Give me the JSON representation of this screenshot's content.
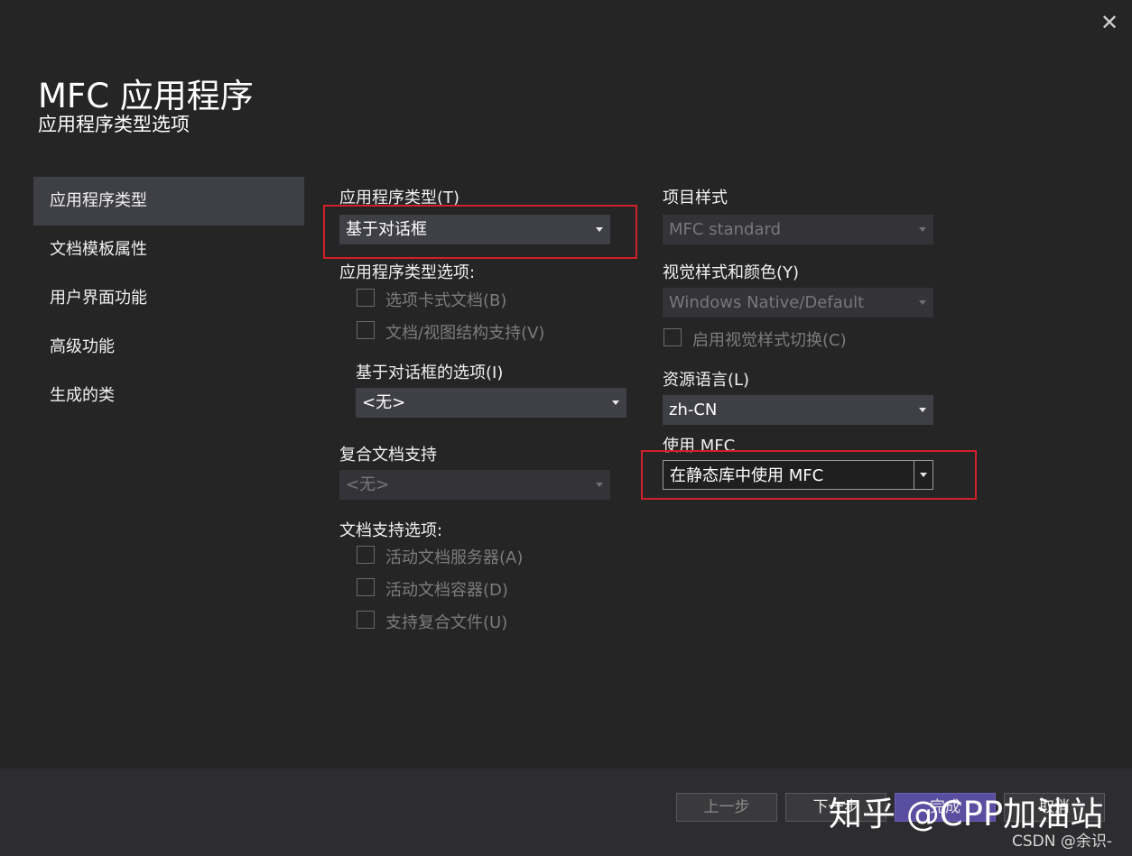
{
  "dialog": {
    "close_glyph": "✕",
    "title": "MFC 应用程序",
    "subtitle": "应用程序类型选项"
  },
  "nav": {
    "items": [
      {
        "label": "应用程序类型",
        "active": true
      },
      {
        "label": "文档模板属性"
      },
      {
        "label": "用户界面功能"
      },
      {
        "label": "高级功能"
      },
      {
        "label": "生成的类"
      }
    ]
  },
  "left_column": {
    "app_type": {
      "label": "应用程序类型(T)",
      "value": "基于对话框"
    },
    "app_type_options": {
      "label": "应用程序类型选项:",
      "checkboxes": [
        {
          "label": "选项卡式文档(B)",
          "checked": false,
          "enabled": false
        },
        {
          "label": "文档/视图结构支持(V)",
          "checked": false,
          "enabled": false
        }
      ]
    },
    "dialog_options": {
      "label": "基于对话框的选项(I)",
      "value": "<无>"
    },
    "compound_doc": {
      "label": "复合文档支持",
      "value": "<无>",
      "enabled": false
    },
    "doc_support": {
      "label": "文档支持选项:",
      "checkboxes": [
        {
          "label": "活动文档服务器(A)",
          "checked": false,
          "enabled": false
        },
        {
          "label": "活动文档容器(D)",
          "checked": false,
          "enabled": false
        },
        {
          "label": "支持复合文件(U)",
          "checked": false,
          "enabled": false
        }
      ]
    }
  },
  "right_column": {
    "project_style": {
      "label": "项目样式",
      "value": "MFC standard",
      "enabled": false
    },
    "visual_style": {
      "label": "视觉样式和颜色(Y)",
      "value": "Windows Native/Default",
      "enabled": false
    },
    "visual_switch": {
      "label": "启用视觉样式切换(C)",
      "checked": false,
      "enabled": false
    },
    "resource_lang": {
      "label": "资源语言(L)",
      "value": "zh-CN"
    },
    "use_mfc": {
      "label": "使用 MFC",
      "value": "在静态库中使用 MFC"
    }
  },
  "footer": {
    "back": "上一步",
    "next": "下一步",
    "finish": "完成",
    "cancel": "取消"
  },
  "overlay": {
    "watermark": "知乎 @CPP加油站",
    "credit": "CSDN @余识-"
  },
  "colors": {
    "background": "#252526",
    "nav_active": "#3f3f46",
    "highlight_box": "#d0202a",
    "primary_button": "#5a4ea0"
  }
}
